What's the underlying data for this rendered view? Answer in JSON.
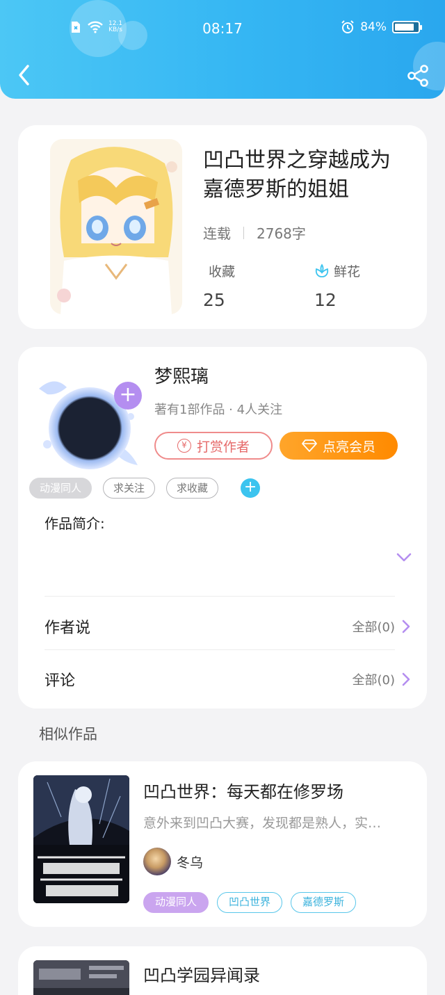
{
  "status_bar": {
    "time": "08:17",
    "net_speed": "12.1",
    "net_unit": "KB/s",
    "battery": "84%",
    "battery_level": 0.84
  },
  "nav": {
    "back_icon": "chevron-left-icon",
    "share_icon": "share-icon"
  },
  "book": {
    "title": "凹凸世界之穿越成为嘉德罗斯的姐姐",
    "status": "连载",
    "word_count": "2768字",
    "favorites_label": "收藏",
    "favorites_value": "25",
    "flowers_label": "鲜花",
    "flowers_value": "12"
  },
  "author": {
    "name": "梦熙璃",
    "sub": "著有1部作品 · 4人关注",
    "tip_label": "打赏作者",
    "tip_icon_text": "¥",
    "vip_label": "点亮会员",
    "follow_plus": "+",
    "tags": [
      "动漫同人",
      "求关注",
      "求收藏"
    ],
    "tag_add": "+",
    "intro_label": "作品简介:",
    "author_says_label": "作者说",
    "author_says_value": "全部(0)",
    "comments_label": "评论",
    "comments_value": "全部(0)"
  },
  "similar": {
    "section_title": "相似作品",
    "items": [
      {
        "title": "凹凸世界：每天都在修罗场",
        "desc": "意外来到凹凸大赛，发现都是熟人，实…",
        "author": "冬乌",
        "tags": [
          "动漫同人",
          "凹凸世界",
          "嘉德罗斯"
        ]
      },
      {
        "title": "凹凸学园异闻录"
      }
    ]
  },
  "colors": {
    "header_blue": "#35b6f3",
    "accent_purple": "#b48ef0",
    "vip_orange": "#ff8a00",
    "tip_red": "#e66a6a",
    "tag_cyan": "#3cc4ef"
  }
}
